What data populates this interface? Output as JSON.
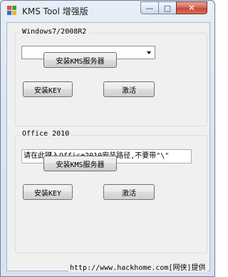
{
  "window": {
    "title": "KMS Tool 增强版",
    "controls": {
      "minimize": "—",
      "maximize": "□",
      "close": "✕"
    }
  },
  "windows_group": {
    "legend": "Windows7/2008R2",
    "edition_select_value": "",
    "install_kms_server_label": "安装KMS服务器",
    "install_key_label": "安装KEY",
    "activate_label": "激活"
  },
  "office_group": {
    "legend": "Office 2010",
    "path_input_value": "请在此键入Office2010安装路径,不要带\"\\\"",
    "install_kms_server_label": "安装KMS服务器",
    "install_key_label": "安装KEY",
    "activate_label": "激活"
  },
  "watermark": "http://www.hackhome.com[网侠]提供",
  "colors": {
    "title_bar": "#dbe6f3",
    "close_button": "#c94f3c",
    "client_background": "#f0f0f0"
  },
  "icons": [
    "app-icon",
    "minimize-icon",
    "maximize-icon",
    "close-icon",
    "dropdown-arrow-icon"
  ]
}
